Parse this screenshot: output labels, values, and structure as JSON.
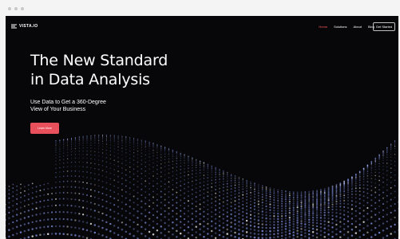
{
  "nav": {
    "logo_text": "VISTA.IO",
    "links": [
      {
        "label": "Home",
        "active": true
      },
      {
        "label": "Solutions",
        "active": false
      },
      {
        "label": "About",
        "active": false
      },
      {
        "label": "Blog",
        "active": false
      }
    ],
    "cta_label": "Get Started"
  },
  "hero": {
    "title_line1": "The New Standard",
    "title_line2": "in Data Analysis",
    "subtitle_line1": "Use Data to Get a 360-Degree",
    "subtitle_line2": "View of Your Business",
    "button_label": "Learn More"
  },
  "colors": {
    "accent": "#e8505b",
    "active_link": "#ff5d5d",
    "background": "#070709",
    "particles": "#7f8fe0"
  },
  "icons": {
    "logo": "layers-logo-icon",
    "window_controls": "window-dot-icon"
  }
}
